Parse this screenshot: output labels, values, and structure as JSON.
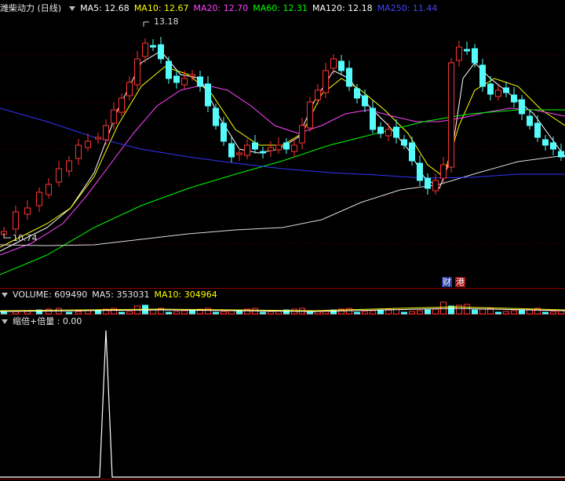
{
  "header": {
    "title": "潍柴动力 (日线)",
    "ma": [
      {
        "label": "MA5: 12.68",
        "color": "#ffffff"
      },
      {
        "label": "MA10: 12.67",
        "color": "#ffff00"
      },
      {
        "label": "MA20: 12.70",
        "color": "#ff44ff"
      },
      {
        "label": "MA60: 12.31",
        "color": "#00ff00"
      },
      {
        "label": "MA120: 12.18",
        "color": "#ffffff"
      },
      {
        "label": "MA250: 11.44",
        "color": "#4444ff"
      }
    ]
  },
  "price_chart": {
    "high_label": "13.18",
    "low_label": "10.74",
    "badge_cai": "财",
    "badge_gang": "港"
  },
  "volume_panel": {
    "volume_label": "VOLUME: 609490",
    "ma5_label": "MA5: 353031",
    "ma10_label": "MA10: 304964"
  },
  "indicator_panel": {
    "label": "缩倍+倍量 : 0.00"
  },
  "colors": {
    "up": "#ff3232",
    "down": "#54fcfc",
    "grid": "#7a0000"
  }
}
